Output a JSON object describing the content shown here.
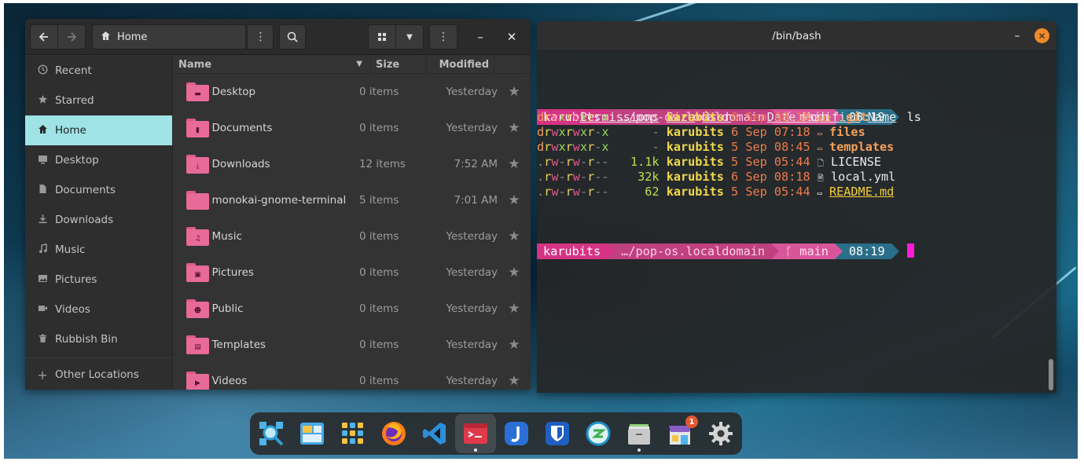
{
  "files": {
    "path_label": "Home",
    "sidebar": [
      {
        "icon": "clock-icon",
        "label": "Recent"
      },
      {
        "icon": "star-icon",
        "label": "Starred"
      },
      {
        "icon": "home-icon",
        "label": "Home",
        "active": true
      },
      {
        "icon": "desktop-icon",
        "label": "Desktop"
      },
      {
        "icon": "document-icon",
        "label": "Documents"
      },
      {
        "icon": "download-icon",
        "label": "Downloads"
      },
      {
        "icon": "music-icon",
        "label": "Music"
      },
      {
        "icon": "picture-icon",
        "label": "Pictures"
      },
      {
        "icon": "video-icon",
        "label": "Videos"
      },
      {
        "icon": "trash-icon",
        "label": "Rubbish Bin"
      }
    ],
    "other_locations": "Other Locations",
    "columns": {
      "name": "Name",
      "size": "Size",
      "modified": "Modified"
    },
    "rows": [
      {
        "name": "Desktop",
        "size": "0 items",
        "modified": "Yesterday",
        "icon": "folder-desktop-icon"
      },
      {
        "name": "Documents",
        "size": "0 items",
        "modified": "Yesterday",
        "icon": "folder-documents-icon"
      },
      {
        "name": "Downloads",
        "size": "12 items",
        "modified": "7:52 AM",
        "icon": "folder-downloads-icon"
      },
      {
        "name": "monokai-gnome-terminal",
        "size": "5 items",
        "modified": "7:01 AM",
        "icon": "folder-icon"
      },
      {
        "name": "Music",
        "size": "0 items",
        "modified": "Yesterday",
        "icon": "folder-music-icon"
      },
      {
        "name": "Pictures",
        "size": "0 items",
        "modified": "Yesterday",
        "icon": "folder-pictures-icon"
      },
      {
        "name": "Public",
        "size": "0 items",
        "modified": "Yesterday",
        "icon": "folder-public-icon"
      },
      {
        "name": "Templates",
        "size": "0 items",
        "modified": "Yesterday",
        "icon": "folder-templates-icon"
      },
      {
        "name": "Videos",
        "size": "0 items",
        "modified": "Yesterday",
        "icon": "folder-videos-icon"
      }
    ]
  },
  "terminal": {
    "title": "/bin/bash",
    "prompt": {
      "user": "karubits",
      "path": "…/pop-os.localdomain",
      "branch": "main",
      "time": "08:19"
    },
    "command": "ls",
    "headers": {
      "permissions": "Permissions",
      "size": "Size",
      "user": "User",
      "date": "Date Modified",
      "name": "Name"
    },
    "entries": [
      {
        "perm_type": "d",
        "perms": [
          "r",
          "w",
          "x",
          "r",
          "w",
          "x",
          "r",
          "-",
          "x"
        ],
        "size": "-",
        "user": "karubits",
        "date": "6 Sep 08:18",
        "icon": "git",
        "name": ".git",
        "kind": "dir"
      },
      {
        "perm_type": "d",
        "perms": [
          "r",
          "w",
          "x",
          "r",
          "w",
          "x",
          "r",
          "-",
          "x"
        ],
        "size": "-",
        "user": "karubits",
        "date": "6 Sep 07:18",
        "icon": "▭",
        "name": "files",
        "kind": "dir"
      },
      {
        "perm_type": "d",
        "perms": [
          "r",
          "w",
          "x",
          "r",
          "w",
          "x",
          "r",
          "-",
          "x"
        ],
        "size": "-",
        "user": "karubits",
        "date": "5 Sep 08:45",
        "icon": "▭",
        "name": "templates",
        "kind": "dir"
      },
      {
        "perm_type": ".",
        "perms": [
          "r",
          "w",
          "-",
          "r",
          "w",
          "-",
          "r",
          "-",
          "-"
        ],
        "size": "1.1k",
        "user": "karubits",
        "date": "5 Sep 05:44",
        "icon": "🗋",
        "name": "LICENSE",
        "kind": "file"
      },
      {
        "perm_type": ".",
        "perms": [
          "r",
          "w",
          "-",
          "r",
          "w",
          "-",
          "r",
          "-",
          "-"
        ],
        "size": "32k",
        "user": "karubits",
        "date": "6 Sep 08:18",
        "icon": "🗎",
        "name": "local.yml",
        "kind": "file"
      },
      {
        "perm_type": ".",
        "perms": [
          "r",
          "w",
          "-",
          "r",
          "w",
          "-",
          "r",
          "-",
          "-"
        ],
        "size": "62",
        "user": "karubits",
        "date": "5 Sep 05:44",
        "icon": "▭",
        "name": "README.md",
        "kind": "readme"
      }
    ],
    "prompt2": {
      "user": "karubits",
      "path": "…/pop-os.localdomain",
      "branch": "main",
      "time": "08:19"
    }
  },
  "dock": {
    "apps": [
      {
        "name": "search-app-icon"
      },
      {
        "name": "workspaces-app-icon"
      },
      {
        "name": "app-grid-icon"
      },
      {
        "name": "firefox-icon"
      },
      {
        "name": "vscode-icon"
      },
      {
        "name": "terminal-app-icon",
        "active": true,
        "running": true
      },
      {
        "name": "joplin-icon"
      },
      {
        "name": "bitwarden-icon"
      },
      {
        "name": "remote-desktop-icon"
      },
      {
        "name": "files-app-icon",
        "running": true
      },
      {
        "name": "store-app-icon",
        "badge": "1"
      },
      {
        "name": "settings-app-icon"
      }
    ]
  }
}
